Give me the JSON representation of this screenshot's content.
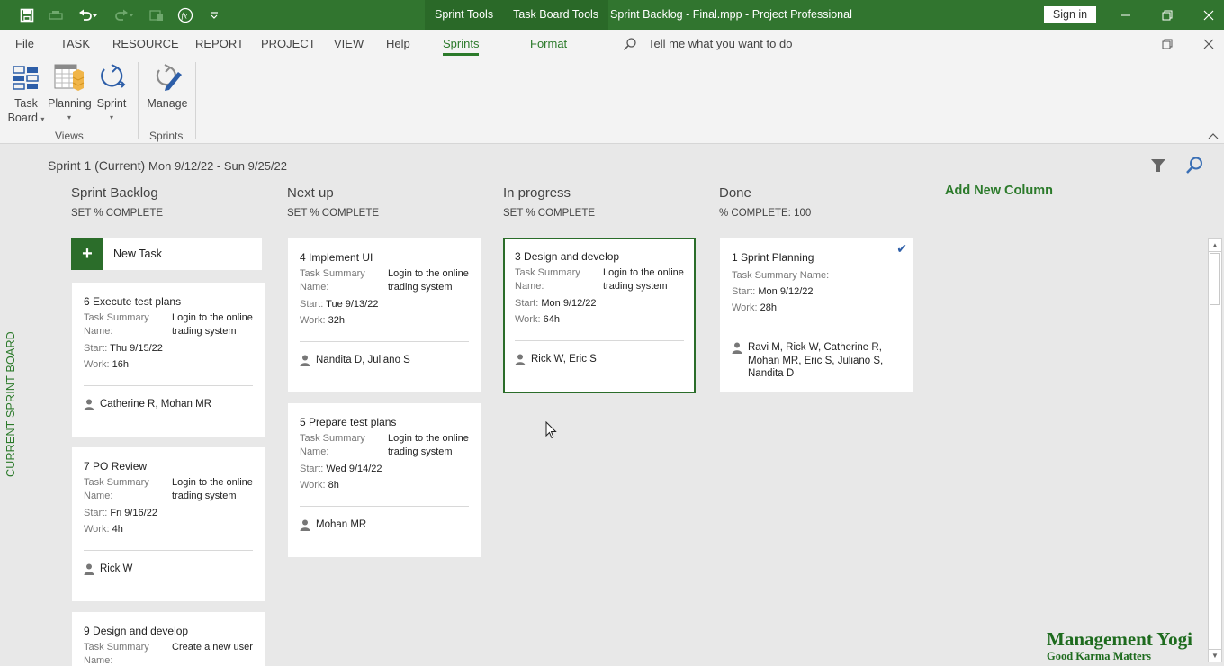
{
  "titlebar": {
    "qat_icons": [
      "save-icon",
      "publish-icon",
      "undo-icon",
      "redo-icon",
      "touch-mode-icon",
      "formula-icon",
      "customize-qat-icon"
    ],
    "context_tabs": [
      "Sprint Tools",
      "Task Board Tools"
    ],
    "window_title": "Sprint Backlog - Final.mpp  -  Project Professional",
    "sign_in": "Sign in",
    "controls": [
      "minimize-icon",
      "restore-icon",
      "close-icon"
    ]
  },
  "menu": {
    "tabs": [
      "File",
      "TASK",
      "RESOURCE",
      "REPORT",
      "PROJECT",
      "VIEW",
      "Help",
      "Sprints",
      "Format"
    ],
    "active_tab": "Sprints",
    "tell_me": "Tell me what you want to do"
  },
  "ribbon": {
    "groups": [
      {
        "label": "Views",
        "buttons": [
          {
            "line1": "Task",
            "line2": "Board",
            "has_dropdown": true,
            "icon": "task-board-icon"
          },
          {
            "line1": "Planning",
            "line2": "",
            "has_dropdown": true,
            "icon": "planning-icon"
          },
          {
            "line1": "Sprint",
            "line2": "",
            "has_dropdown": true,
            "icon": "sprint-icon"
          }
        ]
      },
      {
        "label": "Sprints",
        "buttons": [
          {
            "line1": "Manage",
            "line2": "",
            "has_dropdown": false,
            "icon": "manage-sprints-icon"
          }
        ]
      }
    ],
    "caret": "▾",
    "collapse_glyph": "︿"
  },
  "board": {
    "side_label": "CURRENT SPRINT BOARD",
    "sprint_name": "Sprint 1 (Current)",
    "sprint_dates": "Mon 9/12/22 - Sun 9/25/22",
    "add_column": "Add New Column",
    "new_task": "New Task",
    "new_task_glyph": "+",
    "labels": {
      "task_summary": "Task Summary",
      "name": "Name:",
      "task_summary_name": "Task Summary Name:",
      "start": "Start:",
      "work": "Work:"
    },
    "columns": [
      {
        "name": "Sprint Backlog",
        "percent": "SET % COMPLETE",
        "cards": [
          {
            "id": "6",
            "title": "Execute test plans",
            "summary": "Login to the online trading system",
            "start": "Thu 9/15/22",
            "work": "16h",
            "resources": "Catherine R, Mohan MR"
          },
          {
            "id": "7",
            "title": "PO Review",
            "summary": "Login to the online trading system",
            "start": "Fri 9/16/22",
            "work": "4h",
            "resources": "Rick W"
          },
          {
            "id": "9",
            "title": "Design and develop",
            "summary": "Create a new user",
            "start": "",
            "work": "",
            "resources": ""
          }
        ]
      },
      {
        "name": "Next up",
        "percent": "SET % COMPLETE",
        "cards": [
          {
            "id": "4",
            "title": "Implement UI",
            "summary": "Login to the online trading system",
            "start": "Tue 9/13/22",
            "work": "32h",
            "resources": "Nandita D, Juliano S"
          },
          {
            "id": "5",
            "title": "Prepare test plans",
            "summary": "Login to the online trading system",
            "start": "Wed 9/14/22",
            "work": "8h",
            "resources": "Mohan MR"
          }
        ]
      },
      {
        "name": "In progress",
        "percent": "SET % COMPLETE",
        "cards": [
          {
            "id": "3",
            "title": "Design and develop",
            "summary": "Login to the online trading system",
            "start": "Mon 9/12/22",
            "work": "64h",
            "resources": "Rick W, Eric S",
            "selected": true
          }
        ]
      },
      {
        "name": "Done",
        "percent": "% COMPLETE: 100",
        "cards": [
          {
            "id": "1",
            "title": "Sprint Planning",
            "summary": "",
            "start": "Mon 9/12/22",
            "work": "28h",
            "resources": "Ravi M, Rick W, Catherine R, Mohan MR, Eric S, Juliano S, Nandita D",
            "completed": true
          }
        ]
      }
    ]
  },
  "watermark": {
    "title": "Management Yogi",
    "subtitle": "Good Karma Matters"
  },
  "colors": {
    "brand_green": "#31752f",
    "accent_green": "#2b7a2a",
    "check_blue": "#2d5ea8",
    "board_bg": "#e8e8e8"
  }
}
